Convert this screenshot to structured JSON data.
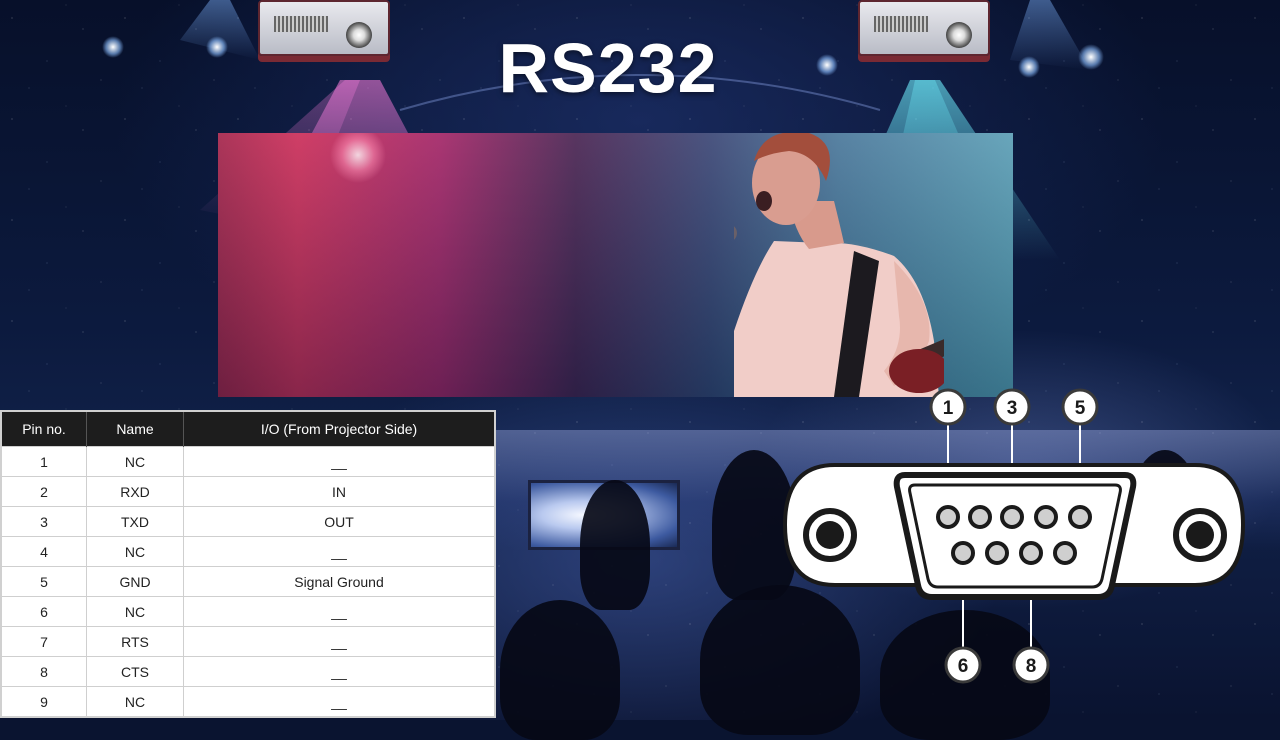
{
  "title": "RS232",
  "table": {
    "headers": [
      "Pin no.",
      "Name",
      "I/O (From Projector Side)"
    ],
    "rows": [
      [
        "1",
        "NC",
        "__"
      ],
      [
        "2",
        "RXD",
        "IN"
      ],
      [
        "3",
        "TXD",
        "OUT"
      ],
      [
        "4",
        "NC",
        "__"
      ],
      [
        "5",
        "GND",
        "Signal Ground"
      ],
      [
        "6",
        "NC",
        "__"
      ],
      [
        "7",
        "RTS",
        "__"
      ],
      [
        "8",
        "CTS",
        "__"
      ],
      [
        "9",
        "NC",
        "__"
      ]
    ]
  },
  "connector": {
    "callouts": [
      "1",
      "3",
      "5",
      "6",
      "8"
    ]
  }
}
